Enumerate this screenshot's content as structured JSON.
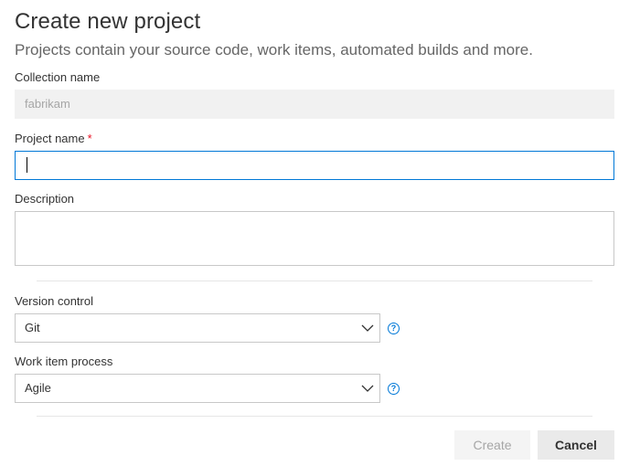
{
  "dialog": {
    "title": "Create new project",
    "subtitle": "Projects contain your source code, work items, automated builds and more."
  },
  "collection": {
    "label": "Collection name",
    "value": "fabrikam"
  },
  "project_name": {
    "label": "Project name",
    "required_mark": "*",
    "value": ""
  },
  "description": {
    "label": "Description",
    "value": ""
  },
  "version_control": {
    "label": "Version control",
    "selected": "Git",
    "help_icon": "question-circle-icon"
  },
  "work_item_process": {
    "label": "Work item process",
    "selected": "Agile",
    "help_icon": "question-circle-icon"
  },
  "buttons": {
    "create_label": "Create",
    "cancel_label": "Cancel"
  },
  "colors": {
    "accent": "#0078d7",
    "required": "#e81123",
    "disabled_text": "#a6a6a6"
  }
}
